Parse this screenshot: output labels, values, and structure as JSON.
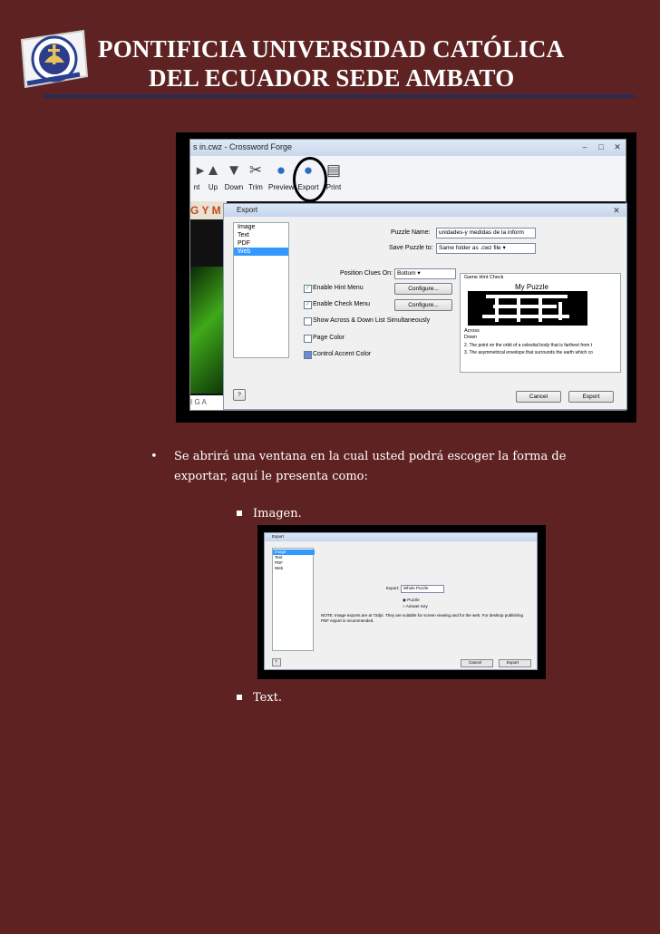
{
  "header": {
    "title_line1": "PONTIFICIA UNIVERSIDAD CATÓLICA",
    "title_line2": "DEL ECUADOR SEDE AMBATO",
    "logo_text": "PONTIFICIA UNIVERSIDAD CATÓLICA DEL ECUADOR · SEDE AMBATO",
    "logo_motto": "ERITIS MIHI TESTES"
  },
  "screenshot1": {
    "window_title": "s in.cwz - Crossword Forge",
    "toolbar": [
      "nt",
      "Up",
      "Down",
      "Trim",
      "Preview",
      "Export",
      "Print"
    ],
    "bg_banner": "G Y M",
    "bg_letters": "I G A",
    "dialog": {
      "title": "Export",
      "formats": [
        "Image",
        "Text",
        "PDF",
        "Web"
      ],
      "selected_format": "Web",
      "puzzle_name_label": "Puzzle Name:",
      "puzzle_name_value": "unidades-y medidas de la inform",
      "save_to_label": "Save Puzzle to:",
      "save_to_value": "Same folder as .cwz file",
      "position_clues_label": "Position Clues On:",
      "position_clues_value": "Bottom",
      "enable_hint": "Enable Hint Menu",
      "enable_check": "Enable Check Menu",
      "configure": "Configure...",
      "show_across_down": "Show Across & Down List Simultaneously",
      "page_color": "Page Color",
      "control_accent": "Control Accent Color",
      "preview_menu": "Game  Hint  Check",
      "preview_title": "My Puzzle",
      "preview_across": "Across",
      "preview_down": "Down",
      "preview_clue1": "2. The point on the orbit of a celestial body that is farthest from t",
      "preview_clue2": "3. The asymmetrical envelope that surrounds the earth which co",
      "help": "?",
      "cancel": "Cancel",
      "export": "Export"
    }
  },
  "body": {
    "bullet_text": "Se abrirá una ventana en la cual usted podrá escoger la forma de exportar, aquí le presenta como:",
    "item_image": "Imagen.",
    "item_text": "Text."
  },
  "screenshot2": {
    "title": "Export",
    "formats": [
      "Image",
      "Text",
      "PDF",
      "Web"
    ],
    "selected_format": "Image",
    "export_label": "Export:",
    "export_value": "Whole Puzzle",
    "opt_puzzle": "Puzzle",
    "opt_answer": "Answer Key",
    "note": "NOTE: Image exports are at 72dpi.  They are suitable for screen viewing and for the web.  For desktop publishing PDF export is recommended.",
    "cancel": "Cancel",
    "export": "Export"
  }
}
